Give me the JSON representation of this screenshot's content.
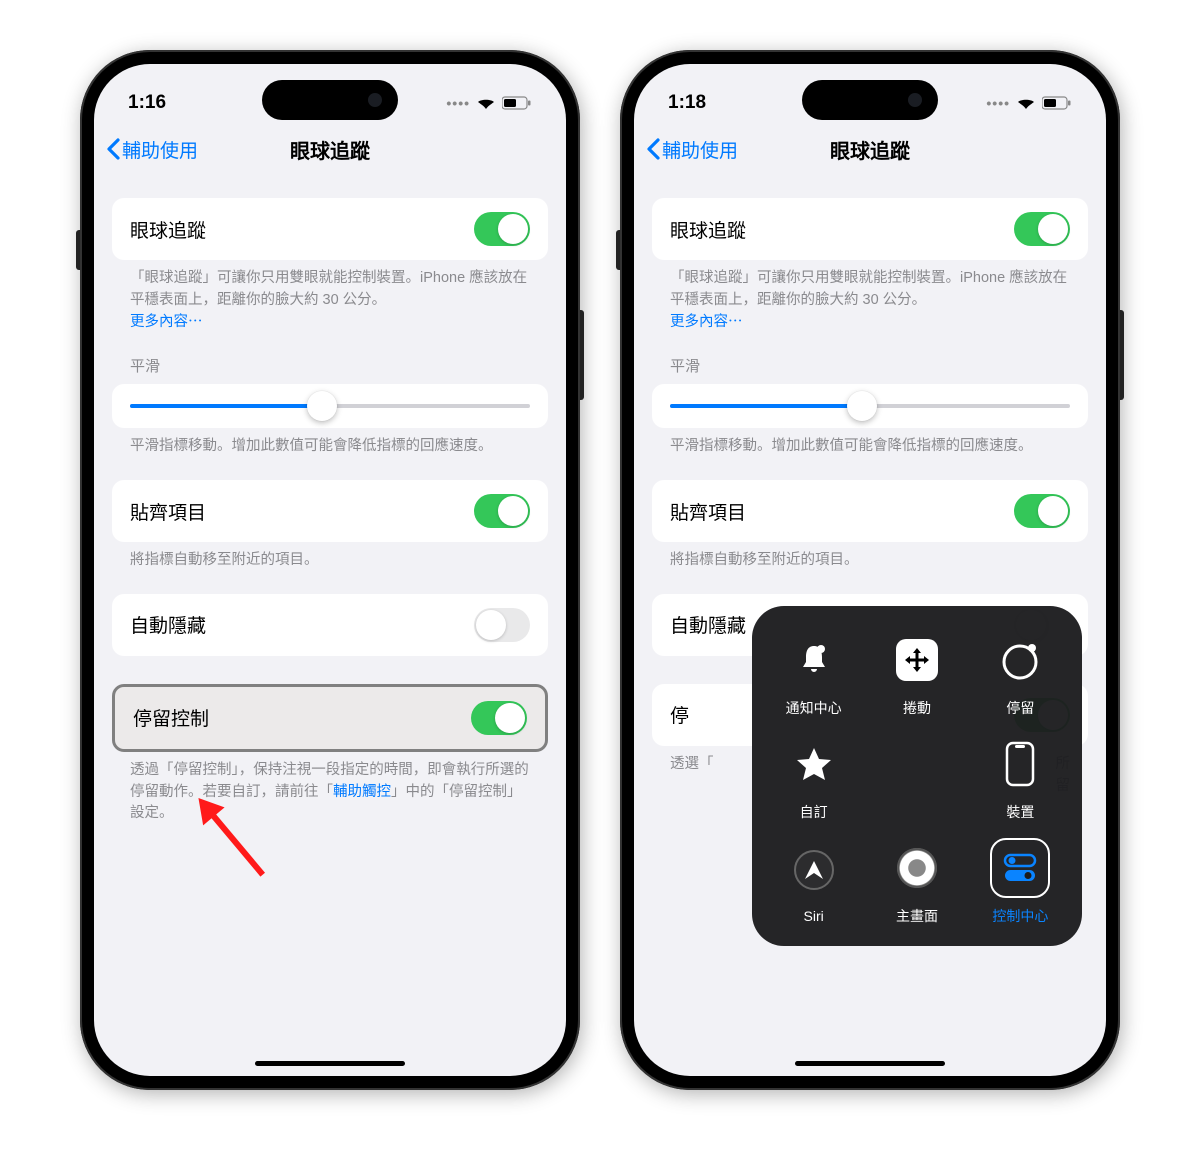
{
  "left": {
    "time": "1:16",
    "back_label": "輔助使用",
    "title": "眼球追蹤",
    "eye_tracking": {
      "label": "眼球追蹤",
      "on": true,
      "footer": "「眼球追蹤」可讓你只用雙眼就能控制裝置。iPhone 應該放在平穩表面上，距離你的臉大約 30 公分。",
      "more_link": "更多內容⋯"
    },
    "smoothing": {
      "header": "平滑",
      "value_pct": 48,
      "footer": "平滑指標移動。增加此數值可能會降低指標的回應速度。"
    },
    "snap": {
      "label": "貼齊項目",
      "on": true,
      "footer": "將指標自動移至附近的項目。"
    },
    "auto_hide": {
      "label": "自動隱藏",
      "on": false
    },
    "dwell": {
      "label": "停留控制",
      "on": true,
      "footer_pre": "透過「停留控制」，保持注視一段指定的時間，即會執行所選的停留動作。若要自訂，請前往「",
      "footer_link": "輔助觸控",
      "footer_post": "」中的「停留控制」設定。"
    }
  },
  "right": {
    "time": "1:18",
    "back_label": "輔助使用",
    "title": "眼球追蹤",
    "eye_tracking": {
      "label": "眼球追蹤",
      "on": true,
      "footer": "「眼球追蹤」可讓你只用雙眼就能控制裝置。iPhone 應該放在平穩表面上，距離你的臉大約 30 公分。",
      "more_link": "更多內容⋯"
    },
    "smoothing": {
      "header": "平滑",
      "value_pct": 48,
      "footer": "平滑指標移動。增加此數值可能會降低指標的回應速度。"
    },
    "snap": {
      "label": "貼齊項目",
      "on": true,
      "footer": "將指標自動移至附近的項目。"
    },
    "auto_hide": {
      "label": "自動隱藏",
      "on": false
    },
    "dwell": {
      "label_partial_left": "停",
      "label_partial_right_top": "所",
      "label_partial_right_mid": "留",
      "footer_partial": "透選「"
    },
    "at_menu": {
      "items": [
        {
          "label": "通知中心",
          "icon": "bell"
        },
        {
          "label": "捲動",
          "icon": "scroll"
        },
        {
          "label": "停留",
          "icon": "dwell"
        },
        {
          "label": "自訂",
          "icon": "star"
        },
        {
          "label": "",
          "icon": ""
        },
        {
          "label": "裝置",
          "icon": "device"
        },
        {
          "label": "Siri",
          "icon": "siri"
        },
        {
          "label": "主畫面",
          "icon": "home"
        },
        {
          "label": "控制中心",
          "icon": "control",
          "selected": true
        }
      ]
    }
  }
}
